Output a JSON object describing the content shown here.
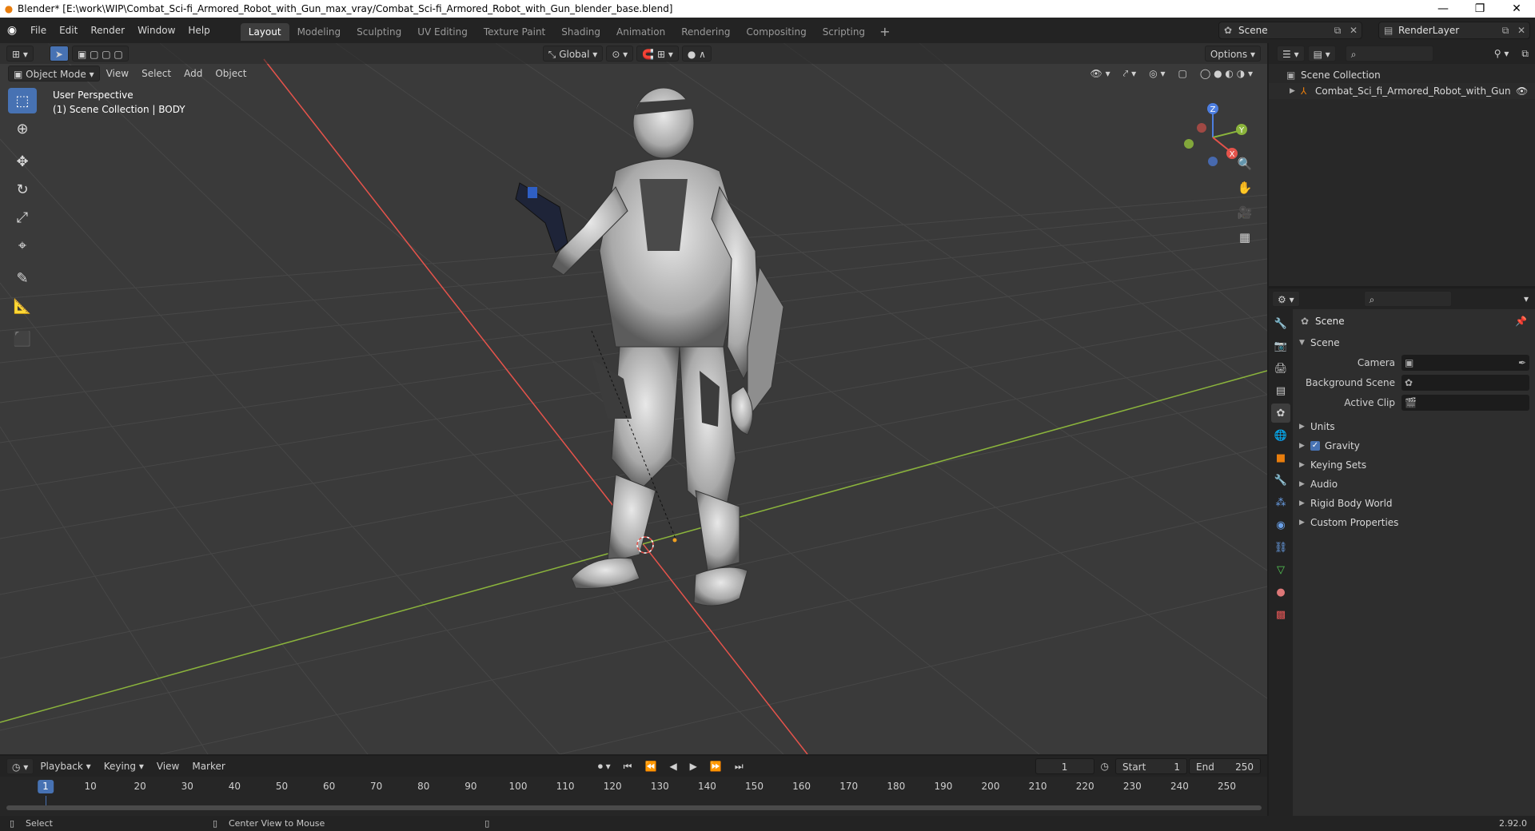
{
  "window": {
    "title": "Blender* [E:\\work\\WIP\\Combat_Sci-fi_Armored_Robot_with_Gun_max_vray/Combat_Sci-fi_Armored_Robot_with_Gun_blender_base.blend]",
    "minimize": "—",
    "restore": "❐",
    "close": "✕"
  },
  "menu": {
    "items": [
      "File",
      "Edit",
      "Render",
      "Window",
      "Help"
    ]
  },
  "workspaces": {
    "tabs": [
      "Layout",
      "Modeling",
      "Sculpting",
      "UV Editing",
      "Texture Paint",
      "Shading",
      "Animation",
      "Rendering",
      "Compositing",
      "Scripting"
    ],
    "active": "Layout",
    "add": "+"
  },
  "scene_selector": {
    "value": "Scene"
  },
  "layer_selector": {
    "value": "RenderLayer"
  },
  "viewport": {
    "mode": "Object Mode",
    "menus": [
      "View",
      "Select",
      "Add",
      "Object"
    ],
    "orientation": "Global",
    "options": "Options",
    "info_line1": "User Perspective",
    "info_line2": "(1) Scene Collection | BODY",
    "gizmo": {
      "x": "X",
      "y": "Y",
      "z": "Z"
    }
  },
  "outliner": {
    "root": "Scene Collection",
    "child": "Combat_Sci_fi_Armored_Robot_with_Gun"
  },
  "properties": {
    "title": "Scene",
    "panel": "Scene",
    "fields": [
      {
        "label": "Camera"
      },
      {
        "label": "Background Scene"
      },
      {
        "label": "Active Clip"
      }
    ],
    "subpanels": [
      "Units",
      "Gravity",
      "Keying Sets",
      "Audio",
      "Rigid Body World",
      "Custom Properties"
    ],
    "gravity_checked": "✓"
  },
  "timeline": {
    "menus": [
      "Playback",
      "Keying",
      "View",
      "Marker"
    ],
    "current_frame": "1",
    "start_label": "Start",
    "start": "1",
    "end_label": "End",
    "end": "250",
    "ticks": [
      "10",
      "20",
      "30",
      "40",
      "50",
      "60",
      "70",
      "80",
      "90",
      "100",
      "110",
      "120",
      "130",
      "140",
      "150",
      "160",
      "170",
      "180",
      "190",
      "200",
      "210",
      "220",
      "230",
      "240",
      "250"
    ],
    "playhead": "1"
  },
  "statusbar": {
    "select": "Select",
    "center": "Center View to Mouse",
    "version": "2.92.0"
  },
  "colors": {
    "accent": "#4772b3",
    "x_axis": "#e5534b",
    "y_axis": "#8bb43c",
    "z_axis": "#4d7ee0"
  }
}
